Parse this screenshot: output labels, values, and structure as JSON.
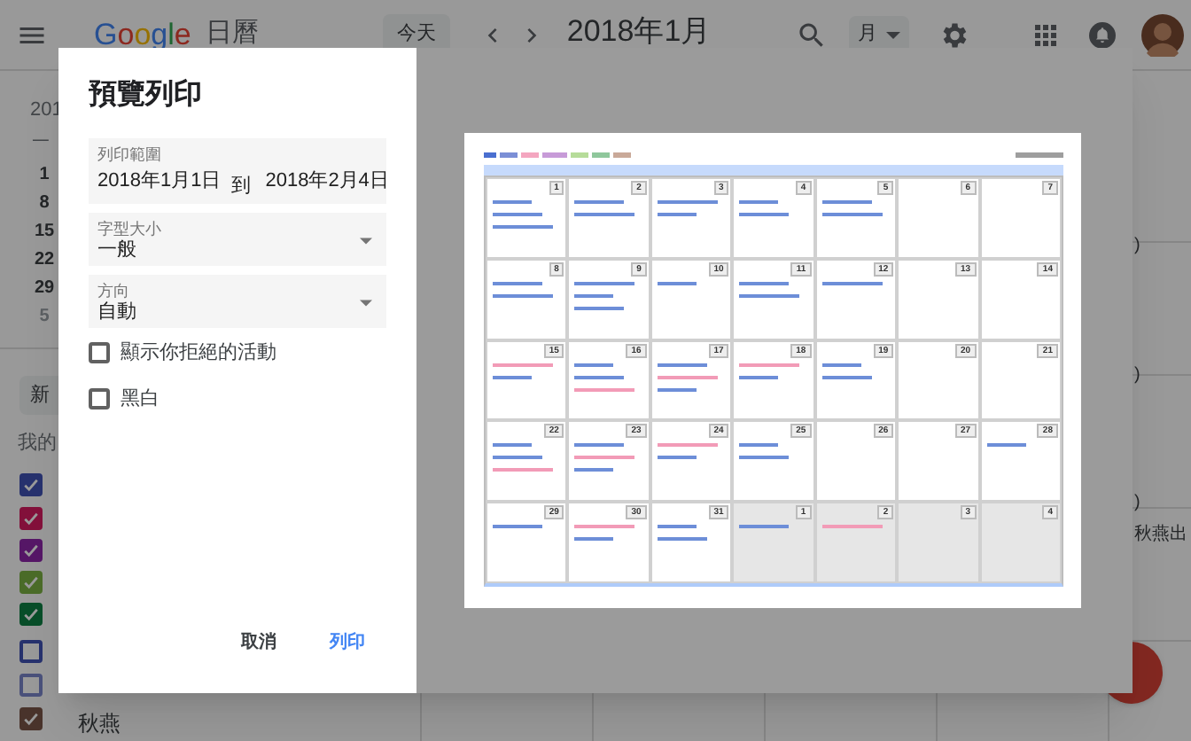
{
  "top_bar": {
    "logo": "Google",
    "app_name": "日曆",
    "today_button": "今天",
    "period": "2018年1月",
    "view_dropdown": "月"
  },
  "sidebar": {
    "mini_calendar": {
      "year": "201",
      "weekday": "一",
      "weeks": [
        {
          "label": "1",
          "other_month": false
        },
        {
          "label": "8",
          "other_month": false
        },
        {
          "label": "15",
          "other_month": false
        },
        {
          "label": "22",
          "other_month": false
        },
        {
          "label": "29",
          "other_month": false
        },
        {
          "label": "5",
          "other_month": true
        }
      ]
    },
    "create_button": "新",
    "section_title": "我的",
    "calendars": [
      {
        "checked": true,
        "color": "#26316d"
      },
      {
        "checked": true,
        "color": "#82103a"
      },
      {
        "checked": true,
        "color": "#551666"
      },
      {
        "checked": true,
        "color": "#4a6b28"
      },
      {
        "checked": true,
        "color": "#074d28"
      },
      {
        "checked": false,
        "color": "#26316d"
      },
      {
        "checked": false,
        "color": "#49507a"
      },
      {
        "checked": true,
        "color": "#49332b",
        "name": "秋燕"
      }
    ]
  },
  "grid_fragments": [
    ")",
    ")",
    ")",
    "秋燕出"
  ],
  "dialog": {
    "title": "預覽列印",
    "range": {
      "label": "列印範圍",
      "from": "2018年1月1日",
      "separator": "到",
      "to": "2018年2月4日"
    },
    "selects": [
      {
        "label": "字型大小",
        "value": "一般"
      },
      {
        "label": "方向",
        "value": "自動"
      }
    ],
    "options": [
      {
        "label": "顯示你拒絕的活動",
        "checked": false
      },
      {
        "label": "黑白",
        "checked": false
      }
    ],
    "buttons": [
      {
        "label": "取消",
        "kind": "secondary"
      },
      {
        "label": "列印",
        "kind": "primary"
      }
    ],
    "preview": {
      "days": [
        {
          "label": "1",
          "other_month": false
        },
        {
          "label": "2",
          "other_month": false
        },
        {
          "label": "3",
          "other_month": false
        },
        {
          "label": "4",
          "other_month": false
        },
        {
          "label": "5",
          "other_month": false
        },
        {
          "label": "6",
          "other_month": false
        },
        {
          "label": "7",
          "other_month": false
        },
        {
          "label": "8",
          "other_month": false
        },
        {
          "label": "9",
          "other_month": false
        },
        {
          "label": "10",
          "other_month": false
        },
        {
          "label": "11",
          "other_month": false
        },
        {
          "label": "12",
          "other_month": false
        },
        {
          "label": "13",
          "other_month": false
        },
        {
          "label": "14",
          "other_month": false
        },
        {
          "label": "15",
          "other_month": false
        },
        {
          "label": "16",
          "other_month": false
        },
        {
          "label": "17",
          "other_month": false
        },
        {
          "label": "18",
          "other_month": false
        },
        {
          "label": "19",
          "other_month": false
        },
        {
          "label": "20",
          "other_month": false
        },
        {
          "label": "21",
          "other_month": false
        },
        {
          "label": "22",
          "other_month": false
        },
        {
          "label": "23",
          "other_month": false
        },
        {
          "label": "24",
          "other_month": false
        },
        {
          "label": "25",
          "other_month": false
        },
        {
          "label": "26",
          "other_month": false
        },
        {
          "label": "27",
          "other_month": false
        },
        {
          "label": "28",
          "other_month": false
        },
        {
          "label": "29",
          "other_month": false
        },
        {
          "label": "30",
          "other_month": false
        },
        {
          "label": "31",
          "other_month": false
        },
        {
          "label": "1",
          "other_month": true
        },
        {
          "label": "2",
          "other_month": true
        },
        {
          "label": "3",
          "other_month": true
        },
        {
          "label": "4",
          "other_month": true
        }
      ]
    }
  }
}
